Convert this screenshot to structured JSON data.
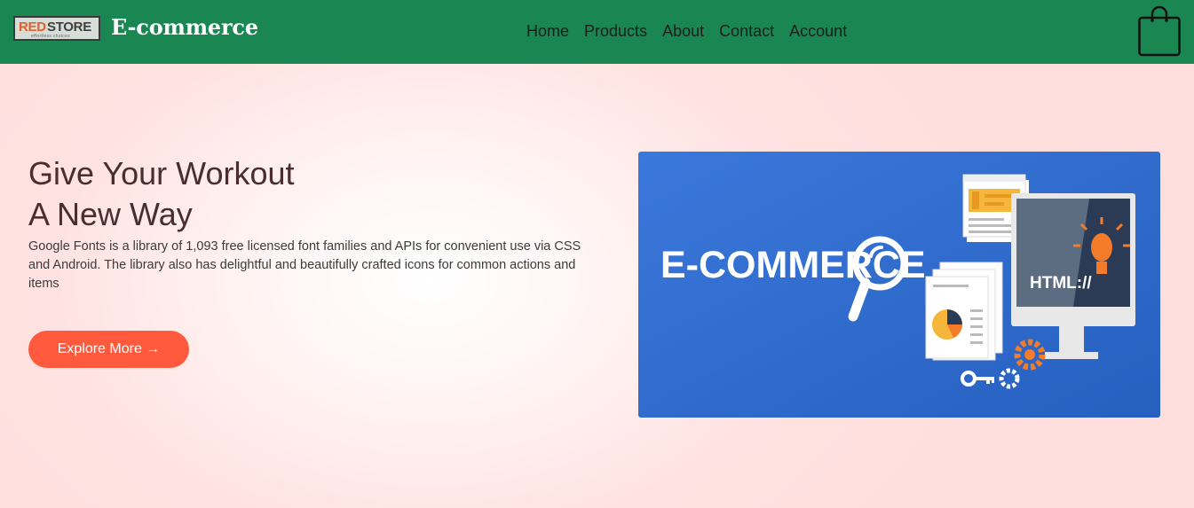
{
  "header": {
    "logo": {
      "text_red": "RED",
      "text_dark": "STORE",
      "tagline": "effortless choices"
    },
    "brand_title": "E-commerce",
    "nav_items": [
      {
        "label": "Home"
      },
      {
        "label": "Products"
      },
      {
        "label": "About"
      },
      {
        "label": "Contact"
      },
      {
        "label": "Account"
      }
    ],
    "cart_icon": "shopping-bag-icon"
  },
  "hero": {
    "title_line1": "Give Your Workout",
    "title_line2": "A New Way",
    "description": "Google Fonts is a library of 1,093 free licensed font families and APIs for convenient use via CSS and Android. The library also has delightful and beautifully crafted icons for common actions and items",
    "cta_label": "Explore More →",
    "image": {
      "heading": "E-COMMERCE",
      "screen_text": "HTML://"
    }
  },
  "colors": {
    "navbar": "#1a8753",
    "cta": "#ff5a3e",
    "title": "#4a2d2e",
    "image_background": "#3370d3"
  }
}
